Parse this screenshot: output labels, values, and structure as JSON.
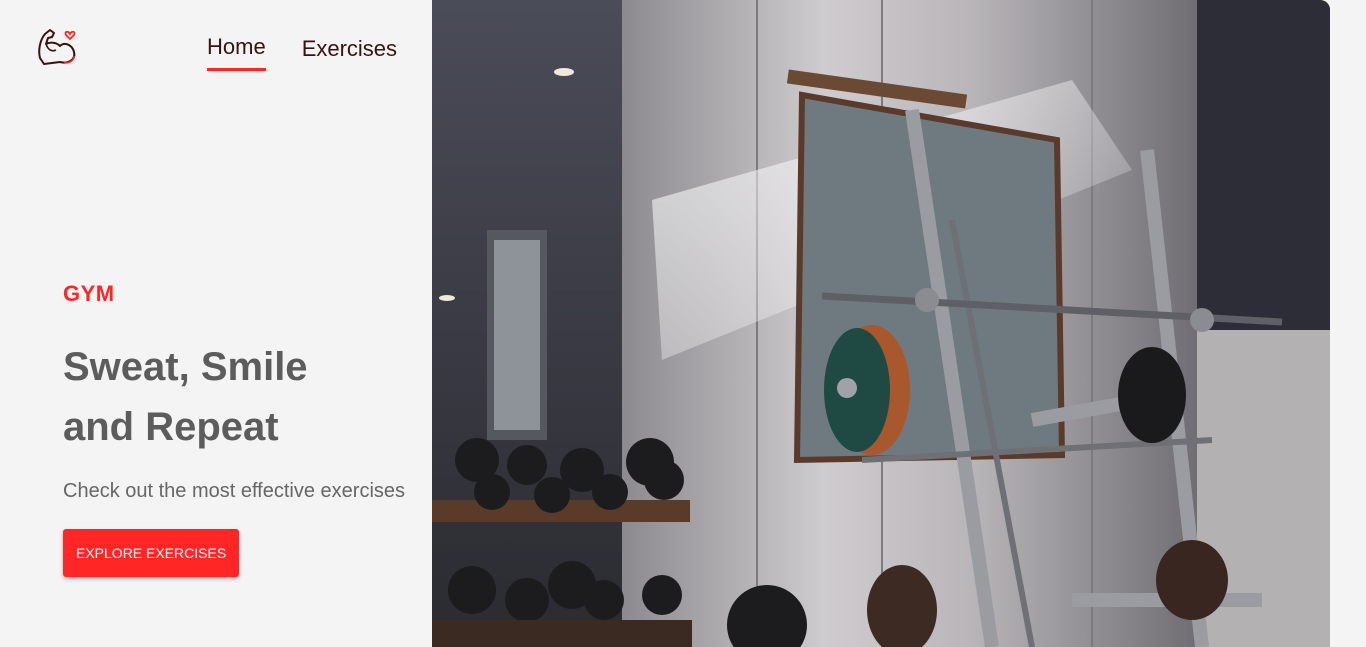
{
  "nav": {
    "links": [
      {
        "label": "Home",
        "active": true
      },
      {
        "label": "Exercises",
        "active": false
      }
    ]
  },
  "hero": {
    "eyebrow": "GYM",
    "headline_line1": "Sweat, Smile",
    "headline_line2": "and Repeat",
    "subtitle": "Check out the most effective exercises",
    "cta_label": "EXPLORE EXERCISES"
  },
  "colors": {
    "accent": "#ff2625",
    "background": "#f4f4f4",
    "headline": "#5c5c5c"
  },
  "icons": {
    "logo": "flexed-bicep-heart-icon"
  }
}
